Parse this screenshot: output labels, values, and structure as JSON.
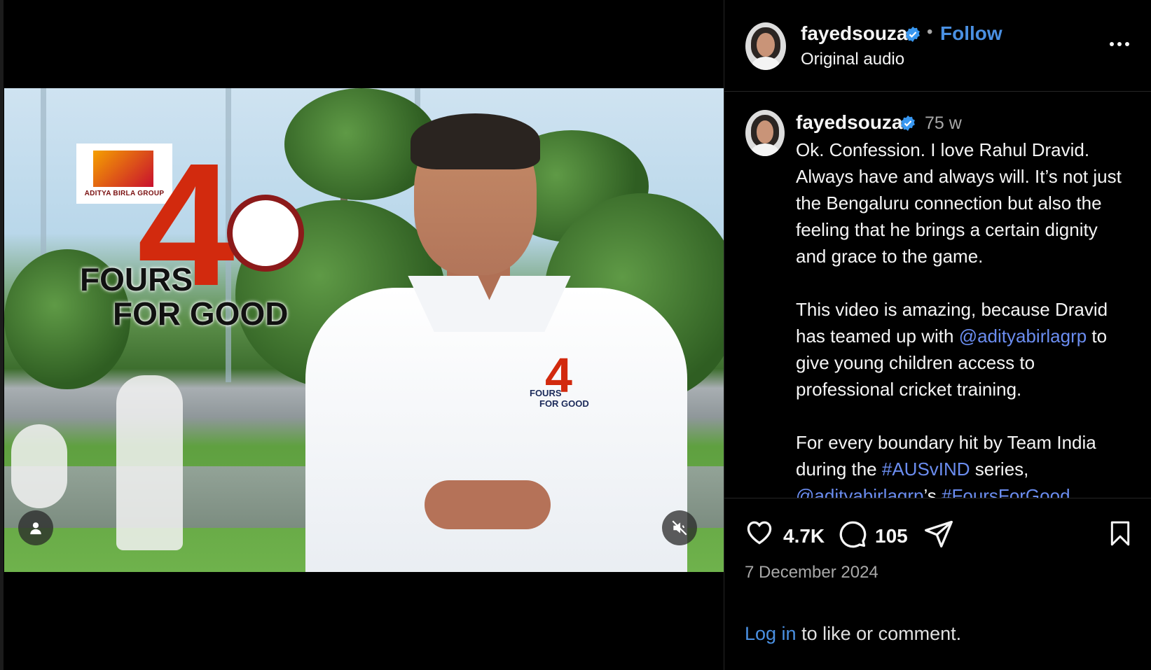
{
  "video": {
    "logo_group": "ADITYA BIRLA GROUP",
    "campaign_number": "4",
    "campaign_line1": "FOURS",
    "campaign_line2": "FOR GOOD",
    "shirt_line1": "FOURS",
    "shirt_line2": "FOR GOOD"
  },
  "header": {
    "username": "fayedsouza",
    "separator": "•",
    "follow_label": "Follow",
    "audio_label": "Original audio"
  },
  "caption": {
    "username": "fayedsouza",
    "time": "75 w",
    "para1": "Ok. Confession. I love Rahul Dravid. Always have and always will. It’s not just the Bengaluru connection but also the feeling that he brings a certain dignity and grace to the game.",
    "para2_a": "This video is amazing, because Dravid has teamed up with ",
    "para2_mention": "@adityabirlagrp",
    "para2_b": " to give young children access to professional cricket training.",
    "para3_a": "For every boundary hit by Team India during the ",
    "para3_hashtag": "#AUSvIND",
    "para3_b": " series, ",
    "para3_mention": "@adityabirlagrp",
    "para3_c": "’s ",
    "para3_hashtag2": "#FoursForGood"
  },
  "actions": {
    "likes": "4.7K",
    "comments": "105",
    "date": "7 December 2024",
    "login_link": "Log in",
    "login_rest": " to like or comment."
  },
  "icons": {
    "verified": "verified-badge-icon",
    "like": "heart-icon",
    "comment": "comment-icon",
    "share": "send-icon",
    "save": "bookmark-icon",
    "mute": "muted-speaker-icon",
    "tags": "user-icon"
  },
  "colors": {
    "accent": "#4a90e2",
    "mention": "#6b8df0",
    "background": "#000000"
  }
}
